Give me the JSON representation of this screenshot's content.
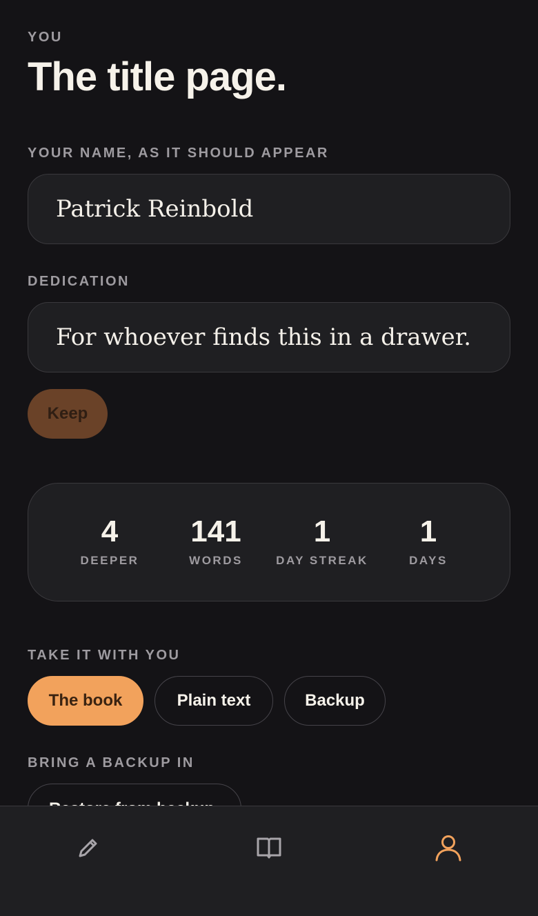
{
  "header": {
    "eyebrow": "YOU",
    "title": "The title page."
  },
  "name_field": {
    "label": "YOUR NAME, AS IT SHOULD APPEAR",
    "value": "Patrick Reinbold"
  },
  "dedication_field": {
    "label": "DEDICATION",
    "value": "For whoever finds this in a drawer."
  },
  "keep_button": {
    "label": "Keep"
  },
  "stats": [
    {
      "value": "4",
      "label": "DEEPER"
    },
    {
      "value": "141",
      "label": "WORDS"
    },
    {
      "value": "1",
      "label": "DAY STREAK"
    },
    {
      "value": "1",
      "label": "DAYS"
    }
  ],
  "export": {
    "label": "TAKE IT WITH YOU",
    "options": [
      "The book",
      "Plain text",
      "Backup"
    ],
    "selected": "The book"
  },
  "import": {
    "label": "BRING A BACKUP IN",
    "button_label": "Restore from backup"
  },
  "bottom_nav": {
    "items": [
      {
        "icon": "pencil-icon",
        "active": false
      },
      {
        "icon": "book-icon",
        "active": false
      },
      {
        "icon": "person-icon",
        "active": true
      }
    ]
  },
  "colors": {
    "background": "#141316",
    "surface": "#1f1f22",
    "accent": "#f2a25c",
    "muted_text": "#9e9ba0"
  }
}
